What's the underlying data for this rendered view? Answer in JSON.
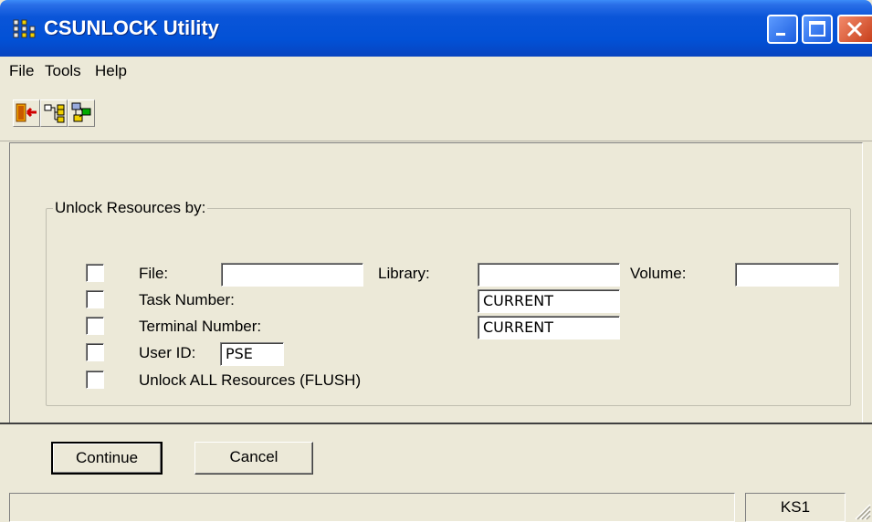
{
  "window": {
    "title": "CSUNLOCK Utility"
  },
  "menu": {
    "items": [
      "File",
      "Tools",
      "Help"
    ]
  },
  "toolbar": {
    "icons": [
      "exit-icon",
      "tree-view-icon",
      "network-icon"
    ]
  },
  "group": {
    "label": "Unlock Resources by:",
    "file_label": "File:",
    "file_value": "",
    "library_label": "Library:",
    "library_value": "",
    "volume_label": "Volume:",
    "volume_value": "",
    "task_label": "Task Number:",
    "task_value": "CURRENT",
    "terminal_label": "Terminal Number:",
    "terminal_value": "CURRENT",
    "user_label": "User ID:",
    "user_value": "PSE",
    "flush_label": "Unlock ALL Resources (FLUSH)"
  },
  "buttons": {
    "continue": "Continue",
    "cancel": "Cancel"
  },
  "status": {
    "panel": "KS1"
  },
  "colors": {
    "title_bar": "#0251d6",
    "face": "#ece9d8"
  }
}
